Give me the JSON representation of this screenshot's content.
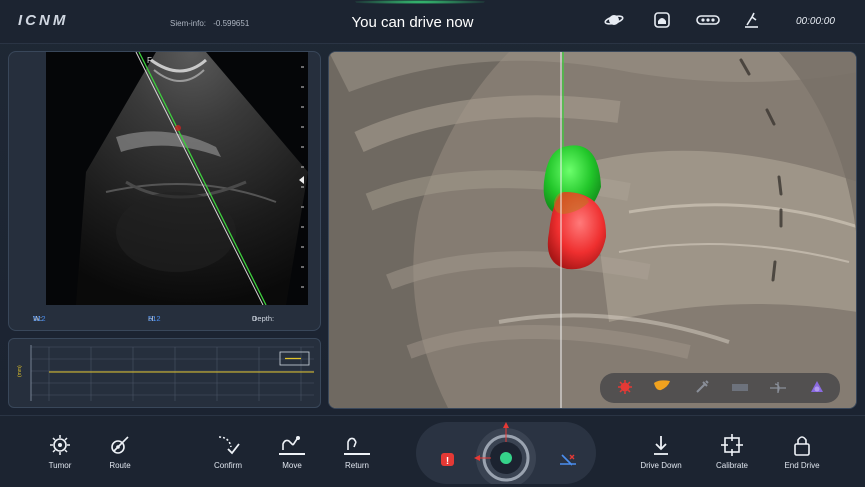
{
  "header": {
    "logo": "ICNM",
    "siem_label": "Siem-info:",
    "siem_value": "-0.599651",
    "status": "You can drive now",
    "timer": "00:00:00",
    "icons": [
      "planet-icon",
      "alarm-icon",
      "device-icon",
      "tool-icon"
    ]
  },
  "ultrasound": {
    "w_label": "W:",
    "w_value": "512",
    "h_label": "H:",
    "h_value": "512",
    "depth_label": "Depth:",
    "depth_value": "0",
    "marker": "F"
  },
  "graph": {
    "y_label": "(mm)",
    "line_color": "#e2c42a"
  },
  "view3d": {
    "tools": [
      "virus-icon",
      "liver-icon",
      "syringe-icon",
      "rectangle-icon",
      "needle-icon",
      "target-icon"
    ],
    "green_color": "#2fcf39",
    "red_color": "#f13a3a"
  },
  "bottom": {
    "tumor": "Tumor",
    "route": "Route",
    "confirm": "Confirm",
    "move": "Move",
    "return": "Return",
    "drive_down": "Drive Down",
    "calibrate": "Calibrate",
    "end_drive": "End Drive"
  },
  "colors": {
    "accent_green": "#35d38a",
    "alert_red": "#e53935",
    "accent_blue": "#4a8ef0"
  }
}
